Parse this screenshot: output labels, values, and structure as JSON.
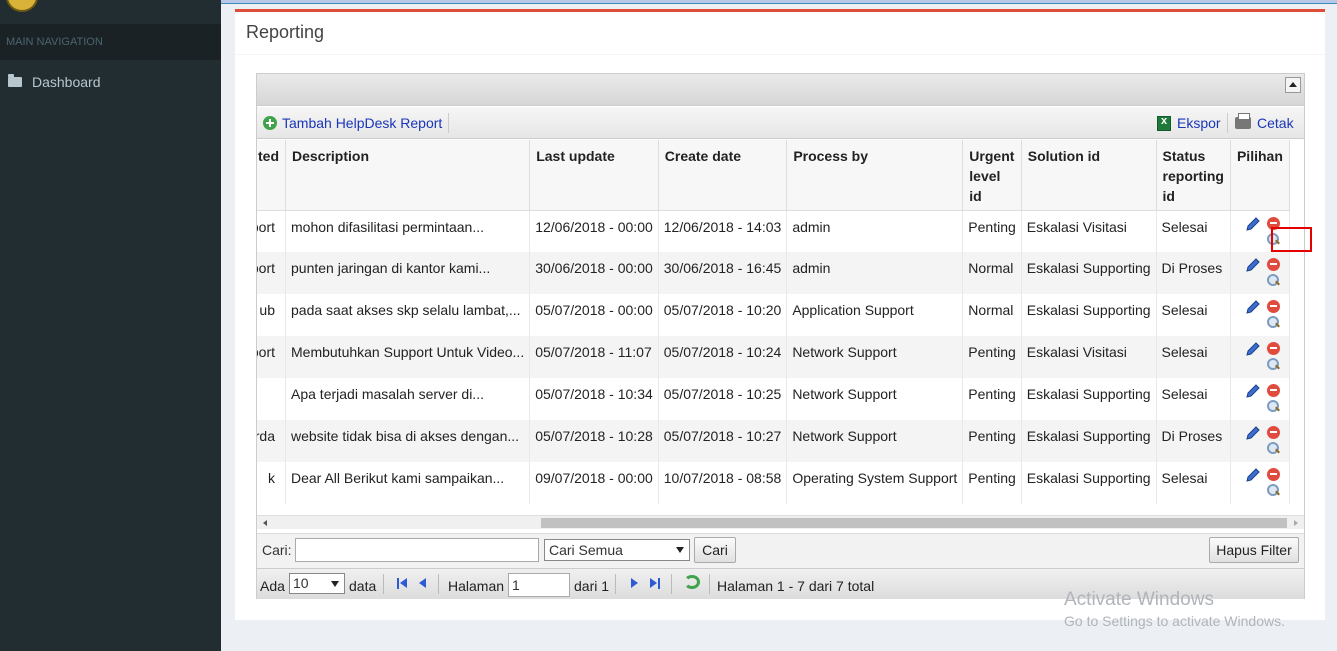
{
  "sidebar": {
    "section_header": "MAIN NAVIGATION",
    "items": [
      {
        "label": "Dashboard",
        "icon": "folder-icon"
      }
    ]
  },
  "page": {
    "title": "Reporting"
  },
  "toolbar": {
    "add_label": "Tambah HelpDesk Report",
    "export_label": "Ekspor",
    "print_label": "Cetak"
  },
  "table": {
    "columns": [
      "ted",
      "Description",
      "Last update",
      "Create date",
      "Process by",
      "Urgent level id",
      "Solution id",
      "Status reporting id",
      "Pilihan"
    ],
    "rows": [
      {
        "c0": "report",
        "desc": "mohon difasilitasi permintaan...",
        "last": "12/06/2018 - 00:00",
        "create": "12/06/2018 - 14:03",
        "by": "admin",
        "urgent": "Penting",
        "solution": "Eskalasi Visitasi",
        "status": "Selesai"
      },
      {
        "c0": "report",
        "desc": "punten jaringan di kantor kami...",
        "last": "30/06/2018 - 00:00",
        "create": "30/06/2018 - 16:45",
        "by": "admin",
        "urgent": "Normal",
        "solution": "Eskalasi Supporting",
        "status": "Di Proses"
      },
      {
        "c0": "ub",
        "desc": "pada saat akses skp selalu lambat,...",
        "last": "05/07/2018 - 00:00",
        "create": "05/07/2018 - 10:20",
        "by": "Application Support",
        "urgent": "Normal",
        "solution": "Eskalasi Supporting",
        "status": "Selesai"
      },
      {
        "c0": "report",
        "desc": "Membutuhkan Support Untuk Video...",
        "last": "05/07/2018 - 11:07",
        "create": "05/07/2018 - 10:24",
        "by": "Network Support",
        "urgent": "Penting",
        "solution": "Eskalasi Visitasi",
        "status": "Selesai"
      },
      {
        "c0": "",
        "desc": "Apa terjadi masalah server di...",
        "last": "05/07/2018 - 10:34",
        "create": "05/07/2018 - 10:25",
        "by": "Network Support",
        "urgent": "Penting",
        "solution": "Eskalasi Supporting",
        "status": "Selesai"
      },
      {
        "c0": "usarda",
        "desc": "website tidak bisa di akses dengan...",
        "last": "05/07/2018 - 10:28",
        "create": "05/07/2018 - 10:27",
        "by": "Network Support",
        "urgent": "Penting",
        "solution": "Eskalasi Supporting",
        "status": "Di Proses"
      },
      {
        "c0": "k",
        "desc": "Dear All Berikut kami sampaikan...",
        "last": "09/07/2018 - 00:00",
        "create": "10/07/2018 - 08:58",
        "by": "Operating System Support",
        "urgent": "Penting",
        "solution": "Eskalasi Supporting",
        "status": "Selesai"
      }
    ]
  },
  "search": {
    "label": "Cari:",
    "input_value": "",
    "select_value": "Cari Semua",
    "search_button": "Cari",
    "clear_button": "Hapus Filter"
  },
  "pager": {
    "ada_label": "Ada",
    "page_size": "10",
    "data_label": "data",
    "halaman_label": "Halaman",
    "page_value": "1",
    "dari_label": "dari 1",
    "summary": "Halaman 1 - 7 dari 7 total"
  },
  "watermark": {
    "line1": "Activate Windows",
    "line2": "Go to Settings to activate Windows."
  }
}
